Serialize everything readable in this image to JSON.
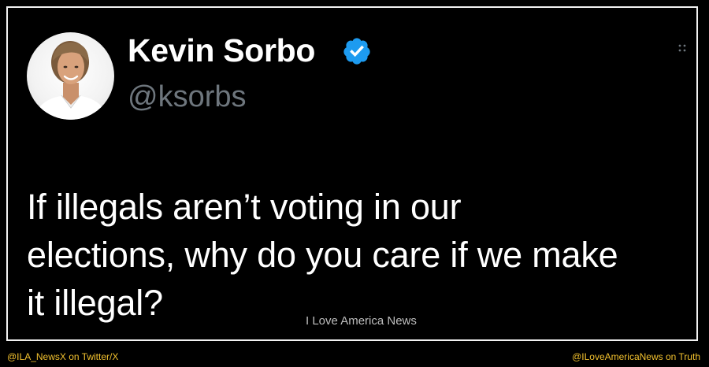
{
  "tweet": {
    "author": {
      "display_name": "Kevin Sorbo",
      "handle": "@ksorbs",
      "verified": true,
      "verified_badge_color": "#1d9bf0"
    },
    "text_lines": [
      "If illegals aren’t voting in our",
      "elections, why do you care if we make",
      "it illegal?"
    ],
    "theme": {
      "background": "#000000",
      "text": "#ffffff",
      "secondary_text": "#6e767d"
    }
  },
  "watermark": "I Love America News",
  "footer": {
    "left": "@ILA_NewsX on Twitter/X",
    "right": "@ILoveAmericaNews on Truth",
    "color": "#f2c12e"
  },
  "icons": {
    "more": "more-options-icon",
    "verified": "verified-badge-icon",
    "avatar": "profile-avatar"
  }
}
